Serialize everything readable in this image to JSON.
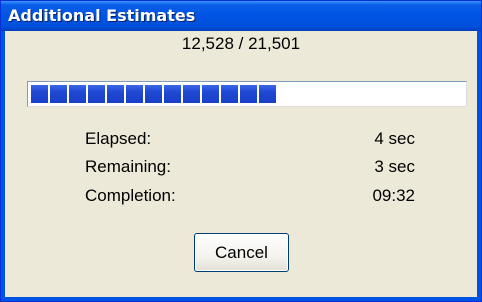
{
  "window": {
    "title": "Additional Estimates"
  },
  "progress": {
    "counter_text": "12,528 / 21,501",
    "current": 12528,
    "total": 21501,
    "fill_fraction": 0.583
  },
  "stats": [
    {
      "label": "Elapsed:",
      "value": "4 sec"
    },
    {
      "label": "Remaining:",
      "value": "3 sec"
    },
    {
      "label": "Completion:",
      "value": "09:32"
    }
  ],
  "buttons": {
    "cancel_label": "Cancel"
  },
  "colors": {
    "titlebar": "#0054e3",
    "progress_fill": "#1f48d4",
    "dialog_bg": "#ece9d8"
  }
}
